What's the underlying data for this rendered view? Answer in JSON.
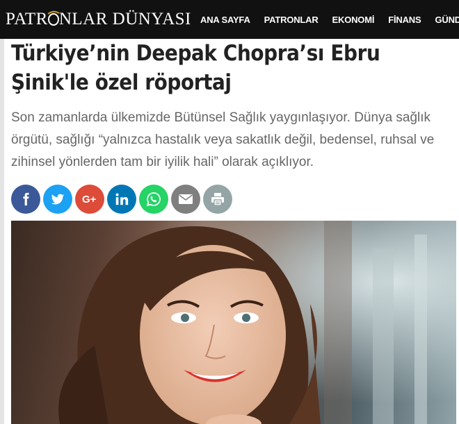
{
  "header": {
    "logo_left": "PATR",
    "logo_right": "NLAR DÜNYASI",
    "nav": [
      "ANA SAYFA",
      "PATRONLAR",
      "EKONOMİ",
      "FİNANS",
      "GÜNDEM"
    ]
  },
  "article": {
    "title": "Türkiye’nin Deepak Chopra’sı Ebru Şinik'le özel röportaj",
    "summary": "Son zamanlarda ülkemizde Bütünsel Sağlık yaygınlaşıyor. Dünya sağlık örgütü, sağlığı “yalnızca hastalık veya sakatlık değil, bedensel, ruhsal ve zihinsel yönlerden tam bir iyilik hali” olarak açıklıyor."
  },
  "share": [
    {
      "icon": "facebook-icon",
      "color": "#3b5998",
      "glyph": "f"
    },
    {
      "icon": "twitter-icon",
      "color": "#1da1f2",
      "glyph": ""
    },
    {
      "icon": "google-plus-icon",
      "color": "#dd4b39",
      "glyph": "G+"
    },
    {
      "icon": "linkedin-icon",
      "color": "#0077b5",
      "glyph": "in"
    },
    {
      "icon": "whatsapp-icon",
      "color": "#25d366",
      "glyph": ""
    },
    {
      "icon": "email-icon",
      "color": "#7f7f7f",
      "glyph": ""
    },
    {
      "icon": "print-icon",
      "color": "#95a5a6",
      "glyph": ""
    }
  ]
}
